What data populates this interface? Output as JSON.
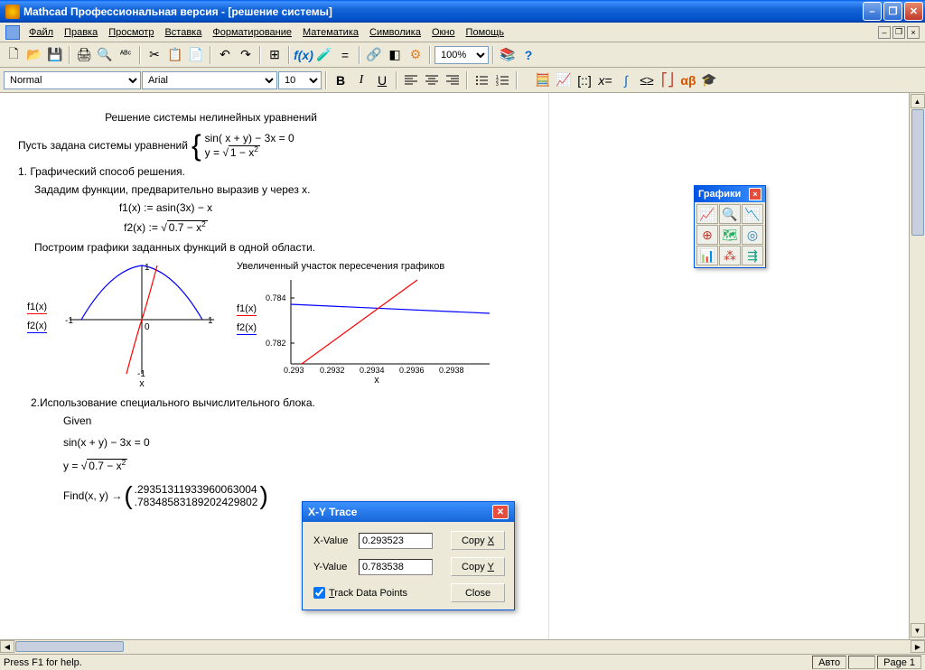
{
  "window": {
    "title": "Mathcad Профессиональная версия - [решение системы]"
  },
  "menu": {
    "items": [
      "Файл",
      "Правка",
      "Просмотр",
      "Вставка",
      "Форматирование",
      "Математика",
      "Символика",
      "Окно",
      "Помощь"
    ]
  },
  "toolbar": {
    "zoom": "100%",
    "style": "Normal",
    "font": "Arial",
    "size": "10"
  },
  "palette": {
    "title": "Графики"
  },
  "doc": {
    "heading": "Решение системы нелинейных уравнений",
    "intro": "Пусть задана системы уравнений",
    "eq1": "sin( x + y) − 3x = 0",
    "eq2_lhs": "y = ",
    "eq2_sqrt": "1 − x",
    "sec1": "1. Графический способ решения.",
    "sec1_1": "Зададим функции, предварительно выразив y через x.",
    "f1def": "f1(x) := asin(3x) − x",
    "f2def_lhs": "f2(x) := ",
    "f2def_sqrt": "0.7 − x",
    "sec1_2": "Построим графики заданных функций в одной области.",
    "g1_f1": "f1(x)",
    "g1_f2": "f2(x)",
    "g2_title": "Увеличенный участок пересечения графиков",
    "sec2": "2.Использование специального вычислительного блока.",
    "given": "Given",
    "usage_eq1": "sin(x + y) − 3x = 0",
    "usage_eq2_lhs": "y = ",
    "usage_eq2_sqrt": "0.7 − x",
    "find_lhs": "Find(x, y) →",
    "find_r1": ".29351311933960063004",
    "find_r2": ".78348583189202429802",
    "x_label": "x"
  },
  "trace": {
    "title": "X-Y Trace",
    "x_label": "X-Value",
    "y_label": "Y-Value",
    "x_value": "0.293523",
    "y_value": "0.783538",
    "copyx": "Copy X",
    "copyy": "Copy Y",
    "track": "Track Data Points",
    "close": "Close"
  },
  "status": {
    "help": "Press F1 for help.",
    "auto": "Авто",
    "page": "Page 1"
  },
  "chart_data": [
    {
      "type": "line",
      "title": "",
      "xlabel": "x",
      "ylabel": "",
      "xlim": [
        -1,
        1
      ],
      "ylim": [
        -1,
        1
      ],
      "series": [
        {
          "name": "f1(x)",
          "color": "red",
          "x": [
            -0.33,
            -0.2,
            -0.1,
            0,
            0.1,
            0.2,
            0.33
          ],
          "y": [
            -1.0,
            -0.45,
            -0.2,
            0,
            0.2,
            0.45,
            1.0
          ]
        },
        {
          "name": "f2(x)",
          "color": "blue",
          "x": [
            -0.837,
            -0.6,
            -0.3,
            0,
            0.3,
            0.6,
            0.837
          ],
          "y": [
            0,
            0.57,
            0.78,
            0.837,
            0.78,
            0.57,
            0
          ]
        }
      ]
    },
    {
      "type": "line",
      "title": "Увеличенный участок пересечения графиков",
      "xlabel": "x",
      "ylabel": "",
      "xlim": [
        0.293,
        0.294
      ],
      "ylim": [
        0.781,
        0.785
      ],
      "yticks": [
        0.782,
        0.784
      ],
      "xticks": [
        0.293,
        0.2932,
        0.2934,
        0.2936,
        0.2938
      ],
      "series": [
        {
          "name": "f1(x)",
          "color": "red",
          "x": [
            0.293,
            0.294
          ],
          "y": [
            0.7815,
            0.7855
          ]
        },
        {
          "name": "f2(x)",
          "color": "blue",
          "x": [
            0.293,
            0.294
          ],
          "y": [
            0.7837,
            0.7833
          ]
        }
      ]
    }
  ]
}
